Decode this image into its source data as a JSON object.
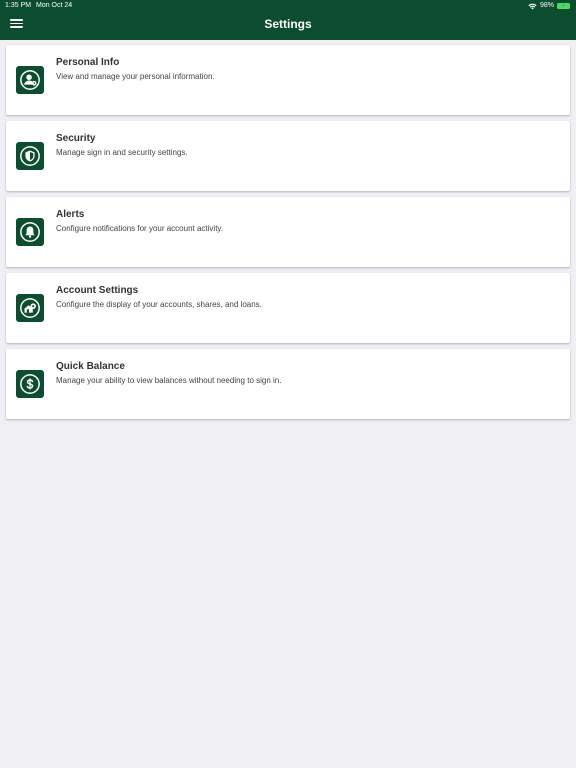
{
  "status_bar": {
    "time": "1:35 PM",
    "date": "Mon Oct 24",
    "battery_percent": "98%"
  },
  "header": {
    "title": "Settings",
    "menu_icon": "hamburger-icon",
    "background": "#0b4d2e"
  },
  "items": [
    {
      "title": "Personal Info",
      "description": "View and manage your personal information.",
      "icon": "person-icon"
    },
    {
      "title": "Security",
      "description": "Manage sign in and security settings.",
      "icon": "shield-icon"
    },
    {
      "title": "Alerts",
      "description": "Configure notifications for your account activity.",
      "icon": "bell-icon"
    },
    {
      "title": "Account Settings",
      "description": "Configure the display of your accounts, shares, and loans.",
      "icon": "account-gear-icon"
    },
    {
      "title": "Quick Balance",
      "description": "Manage your ability to view balances without needing to sign in.",
      "icon": "dollar-icon"
    }
  ]
}
